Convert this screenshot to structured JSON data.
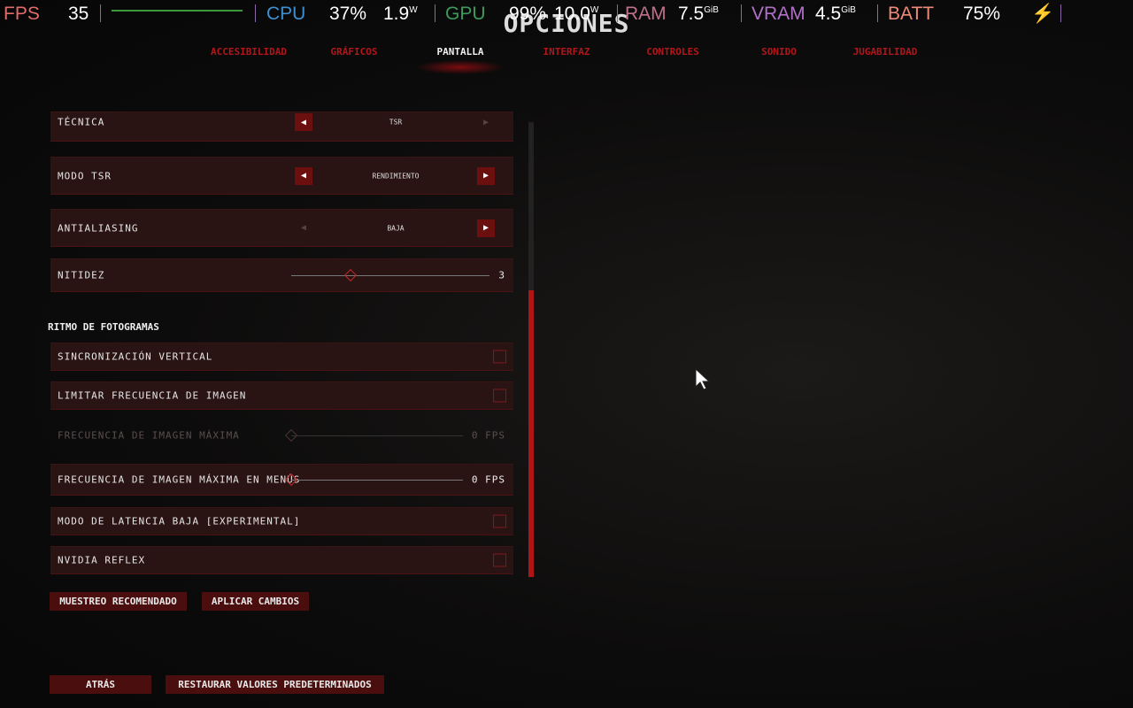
{
  "osd": {
    "fps_label": "FPS",
    "fps": "35",
    "cpu_label": "CPU",
    "cpu_load": "37%",
    "cpu_power": "1.9",
    "cpu_power_unit": "W",
    "gpu_label": "GPU",
    "gpu_load": "99%",
    "gpu_power": "10.0",
    "gpu_power_unit": "W",
    "ram_label": "RAM",
    "ram": "7.5",
    "ram_unit": "GiB",
    "vram_label": "VRAM",
    "vram": "4.5",
    "vram_unit": "GiB",
    "batt_label": "BATT",
    "batt": "75%",
    "plug_icon": "power-plug-icon"
  },
  "title": "OPCIONES",
  "tabs": [
    {
      "label": "ACCESIBILIDAD"
    },
    {
      "label": "GRÁFICOS"
    },
    {
      "label": "PANTALLA",
      "active": true
    },
    {
      "label": "INTERFAZ"
    },
    {
      "label": "CONTROLES"
    },
    {
      "label": "SONIDO"
    },
    {
      "label": "JUGABILIDAD"
    }
  ],
  "settings": {
    "tecnica": {
      "label": "TÉCNICA",
      "value": "TSR"
    },
    "modo_tsr": {
      "label": "MODO TSR",
      "value": "RENDIMIENTO"
    },
    "antialiasing": {
      "label": "ANTIALIASING",
      "value": "BAJA"
    },
    "nitidez": {
      "label": "NITIDEZ",
      "value": "3",
      "fraction": 0.3
    }
  },
  "frame_section": {
    "title": "RITMO DE FOTOGRAMAS",
    "vsync": {
      "label": "SINCRONIZACIÓN VERTICAL",
      "checked": false
    },
    "limit": {
      "label": "LIMITAR FRECUENCIA DE IMAGEN",
      "checked": false
    },
    "max_fps": {
      "label": "FRECUENCIA DE IMAGEN MÁXIMA",
      "value": "0 FPS",
      "disabled": true
    },
    "max_fps_menus": {
      "label": "FRECUENCIA DE IMAGEN MÁXIMA EN MENÚS",
      "value": "0 FPS"
    },
    "low_latency": {
      "label": "MODO DE LATENCIA BAJA [EXPERIMENTAL]",
      "checked": false
    },
    "reflex": {
      "label": "NVIDIA REFLEX",
      "checked": false
    }
  },
  "buttons": {
    "recommended": "MUESTREO RECOMENDADO",
    "apply": "APLICAR CAMBIOS",
    "back": "ATRÁS",
    "restore": "RESTAURAR VALORES PREDETERMINADOS"
  }
}
